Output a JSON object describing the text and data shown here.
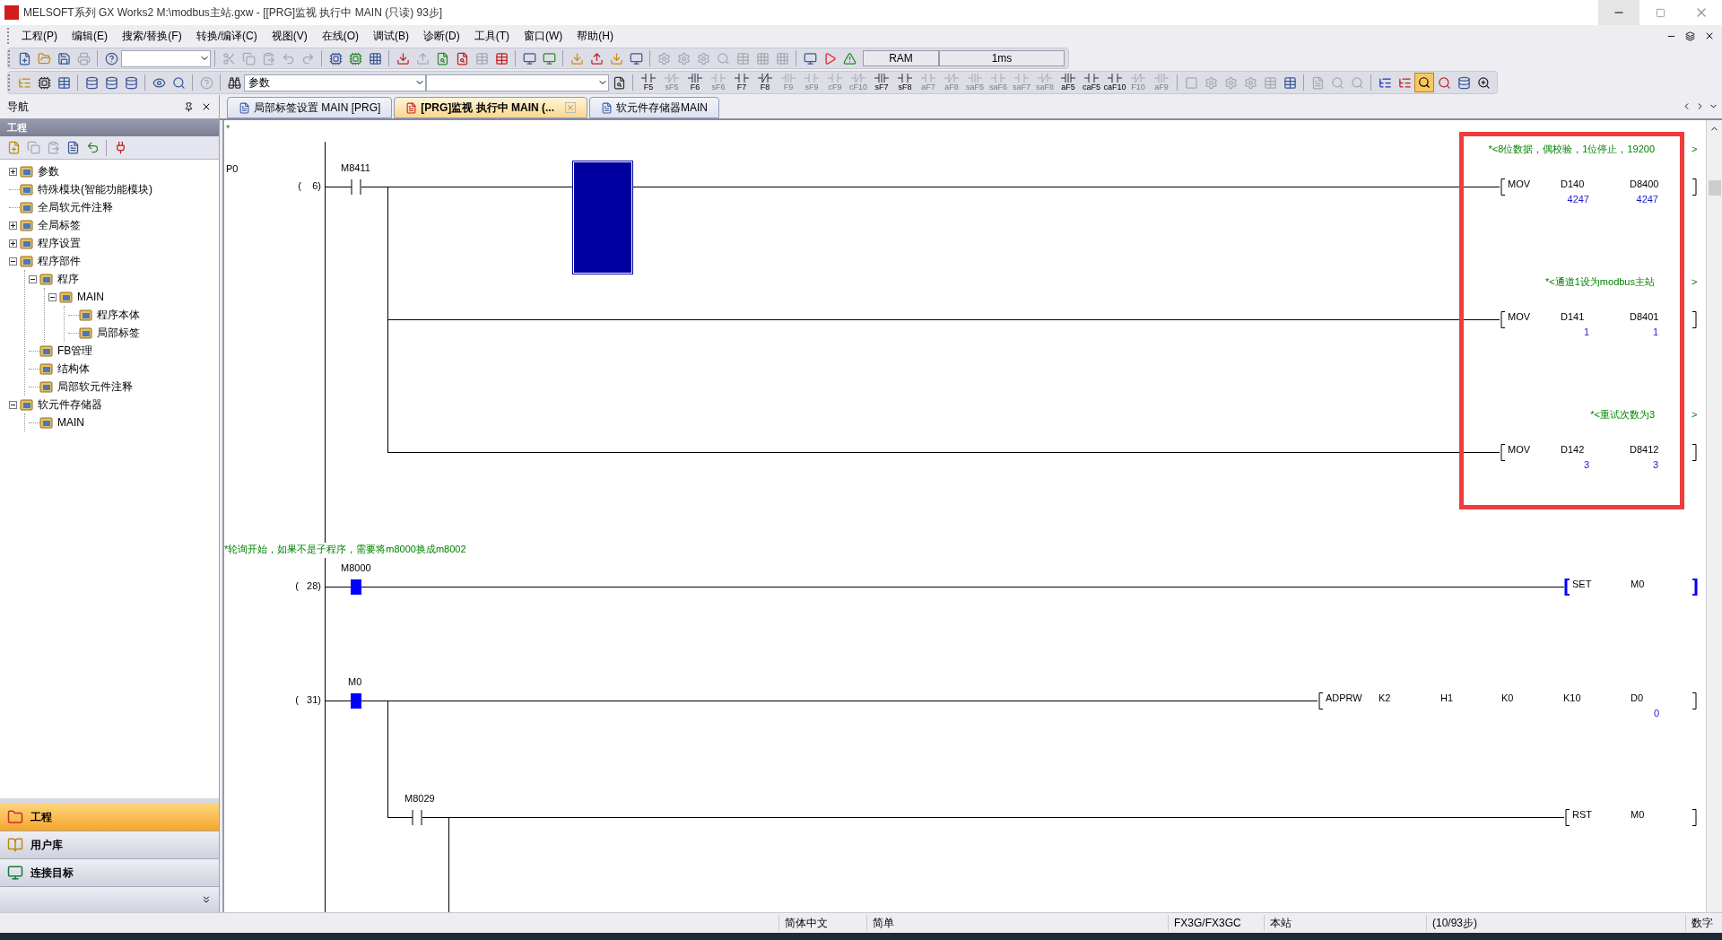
{
  "window": {
    "title": "MELSOFT系列 GX Works2 M:\\modbus主站.gxw - [[PRG]监视 执行中 MAIN (只读) 93步]"
  },
  "menu": [
    "工程(P)",
    "编辑(E)",
    "搜索/替换(F)",
    "转换/编译(C)",
    "视图(V)",
    "在线(O)",
    "调试(B)",
    "诊断(D)",
    "工具(T)",
    "窗口(W)",
    "帮助(H)"
  ],
  "toolbar": {
    "combo_value": "参数",
    "memory": "RAM",
    "scan_time": "1ms"
  },
  "ladder_keys": [
    {
      "label": "F5",
      "disabled": false
    },
    {
      "label": "sF5",
      "disabled": true
    },
    {
      "label": "F6",
      "disabled": false
    },
    {
      "label": "sF6",
      "disabled": true
    },
    {
      "label": "F7",
      "disabled": false
    },
    {
      "label": "F8",
      "disabled": false
    },
    {
      "label": "F9",
      "disabled": true
    },
    {
      "label": "sF9",
      "disabled": true
    },
    {
      "label": "cF9",
      "disabled": true
    },
    {
      "label": "cF10",
      "disabled": true
    },
    {
      "label": "sF7",
      "disabled": false
    },
    {
      "label": "sF8",
      "disabled": false
    },
    {
      "label": "aF7",
      "disabled": true
    },
    {
      "label": "aF8",
      "disabled": true
    },
    {
      "label": "saF5",
      "disabled": true
    },
    {
      "label": "saF6",
      "disabled": true
    },
    {
      "label": "saF7",
      "disabled": true
    },
    {
      "label": "saF8",
      "disabled": true
    },
    {
      "label": "aF5",
      "disabled": false
    },
    {
      "label": "caF5",
      "disabled": false
    },
    {
      "label": "caF10",
      "disabled": false
    },
    {
      "label": "F10",
      "disabled": true
    },
    {
      "label": "aF9",
      "disabled": true
    }
  ],
  "navigation": {
    "title": "导航",
    "section": "工程",
    "tree": [
      {
        "label": "参数",
        "expanded": false
      },
      {
        "label": "特殊模块(智能功能模块)"
      },
      {
        "label": "全局软元件注释"
      },
      {
        "label": "全局标签",
        "expanded": false
      },
      {
        "label": "程序设置",
        "expanded": false
      },
      {
        "label": "程序部件",
        "expanded": true,
        "children": [
          {
            "label": "程序",
            "expanded": true,
            "children": [
              {
                "label": "MAIN",
                "expanded": true,
                "children": [
                  {
                    "label": "程序本体"
                  },
                  {
                    "label": "局部标签"
                  }
                ]
              }
            ]
          },
          {
            "label": "FB管理"
          },
          {
            "label": "结构体"
          },
          {
            "label": "局部软元件注释"
          }
        ]
      },
      {
        "label": "软元件存储器",
        "expanded": true,
        "children": [
          {
            "label": "MAIN"
          }
        ]
      }
    ],
    "panels": [
      {
        "label": "工程",
        "selected": true
      },
      {
        "label": "用户库",
        "selected": false
      },
      {
        "label": "连接目标",
        "selected": false
      }
    ]
  },
  "tabs": [
    {
      "label": "局部标签设置 MAIN [PRG]",
      "selected": false
    },
    {
      "label": "[PRG]监视 执行中 MAIN (...",
      "selected": true
    },
    {
      "label": "软元件存储器MAIN",
      "selected": false
    }
  ],
  "ladder": {
    "top_mark": "*",
    "label": "P0",
    "rungs": [
      {
        "step": "(    6)",
        "contacts": [
          {
            "device": "M8411",
            "on": false
          }
        ],
        "outputs": [
          {
            "comment": "*<8位数据，偶校验，1位停止，19200",
            "more": ">",
            "op": "MOV",
            "on": false,
            "operands": [
              {
                "device": "D140",
                "value": "4247"
              },
              {
                "device": "D8400",
                "value": "4247"
              }
            ]
          },
          {
            "comment": "*<通道1设为modbus主站",
            "more": ">",
            "op": "MOV",
            "on": false,
            "operands": [
              {
                "device": "D141",
                "value": "1"
              },
              {
                "device": "D8401",
                "value": "1"
              }
            ]
          },
          {
            "comment": "*<重试次数为3",
            "more": ">",
            "op": "MOV",
            "on": false,
            "operands": [
              {
                "device": "D142",
                "value": "3"
              },
              {
                "device": "D8412",
                "value": "3"
              }
            ]
          }
        ]
      },
      {
        "comment": "*轮询开始，如果不是子程序，需要将m8000换成m8002",
        "step": "(   28)",
        "contacts": [
          {
            "device": "M8000",
            "on": true
          }
        ],
        "outputs": [
          {
            "op": "SET",
            "on": true,
            "operands": [
              {
                "device": "M0"
              }
            ]
          }
        ]
      },
      {
        "step": "(   31)",
        "contacts": [
          {
            "device": "M0",
            "on": true
          }
        ],
        "outputs": [
          {
            "op": "ADPRW",
            "on": false,
            "operands": [
              {
                "device": "K2"
              },
              {
                "device": "H1"
              },
              {
                "device": "K0"
              },
              {
                "device": "K10"
              },
              {
                "device": "D0",
                "value": "0"
              }
            ]
          }
        ],
        "branch": {
          "contacts": [
            {
              "device": "M8029",
              "on": false
            }
          ],
          "outputs": [
            {
              "op": "RST",
              "on": false,
              "operands": [
                {
                  "device": "M0"
                }
              ]
            }
          ]
        }
      }
    ]
  },
  "status_bar": [
    "简体中文",
    "简单",
    "FX3G/FX3GC",
    "本站",
    "(10/93步)",
    "数字"
  ]
}
